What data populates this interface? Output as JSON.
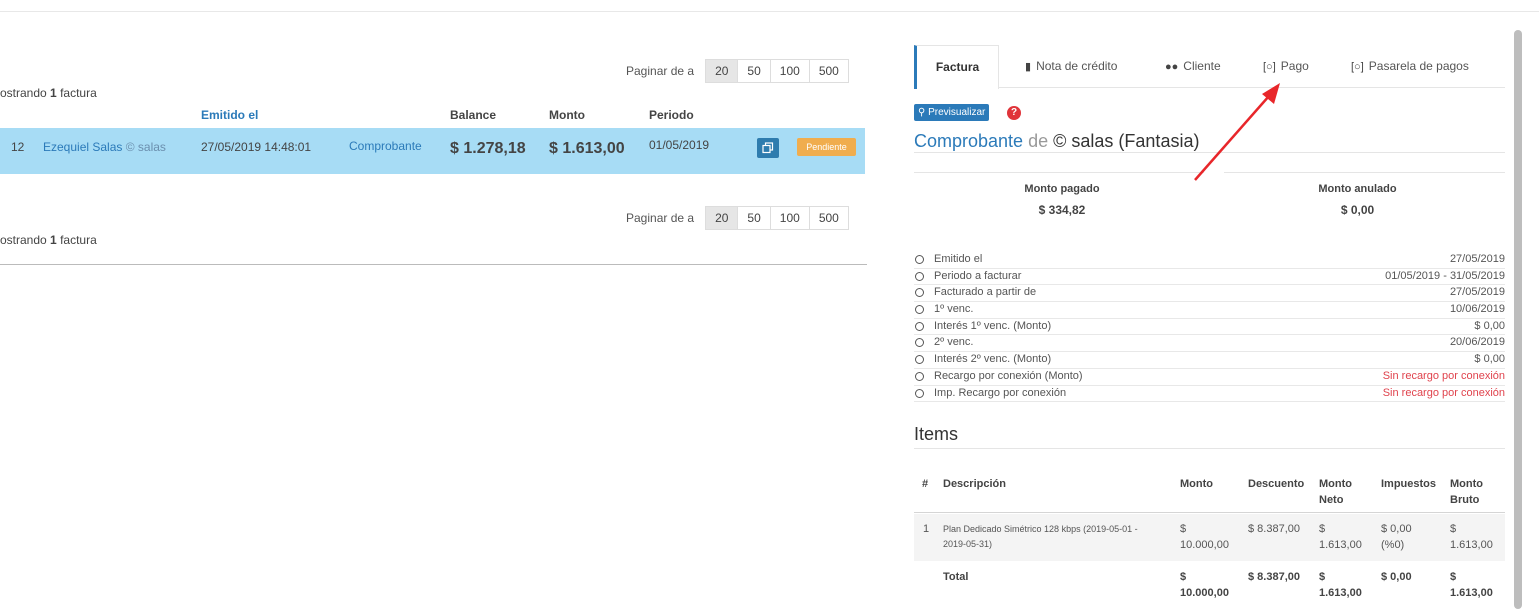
{
  "pager_top": {
    "label": "Paginar de a",
    "options": [
      "20",
      "50",
      "100",
      "500"
    ],
    "active": "20"
  },
  "pager_bottom": {
    "label": "Paginar de a",
    "options": [
      "20",
      "50",
      "100",
      "500"
    ],
    "active": "20"
  },
  "showing_top": {
    "prefix": "ostrando",
    "count": "1",
    "suffix": "factura"
  },
  "showing_bottom": {
    "prefix": "ostrando",
    "count": "1",
    "suffix": "factura"
  },
  "table": {
    "headers": {
      "emitted": "Emitido el",
      "balance": "Balance",
      "amount": "Monto",
      "period": "Periodo"
    },
    "row": {
      "id": "12",
      "client": "Ezequiel Salas",
      "client_tag": "© salas",
      "emitted": "27/05/2019 14:48:01",
      "type": "Comprobante",
      "balance": "$ 1.278,18",
      "amount": "$ 1.613,00",
      "period": "01/05/2019",
      "status": "Pendiente"
    }
  },
  "tabs": [
    {
      "label": "Factura",
      "icon": ""
    },
    {
      "label": "Nota de crédito",
      "icon": "book-icon"
    },
    {
      "label": "Cliente",
      "icon": "users-icon"
    },
    {
      "label": "Pago",
      "icon": "money-icon"
    },
    {
      "label": "Pasarela de pagos",
      "icon": "money-icon"
    }
  ],
  "detail": {
    "preview_label": "Previsualizar",
    "title": {
      "doc": "Comprobante",
      "de": "de",
      "name": "© salas (Fantasia)"
    },
    "paid_label": "Monto pagado",
    "paid_value": "$ 334,82",
    "void_label": "Monto anulado",
    "void_value": "$ 0,00",
    "fields": [
      {
        "k": "Emitido el",
        "v": "27/05/2019"
      },
      {
        "k": "Periodo a facturar",
        "v": "01/05/2019 - 31/05/2019"
      },
      {
        "k": "Facturado a partir de",
        "v": "27/05/2019"
      },
      {
        "k": "1º venc.",
        "v": "10/06/2019"
      },
      {
        "k": "Interés 1º venc. (Monto)",
        "v": "$ 0,00"
      },
      {
        "k": "2º venc.",
        "v": "20/06/2019"
      },
      {
        "k": "Interés 2º venc. (Monto)",
        "v": "$ 0,00"
      },
      {
        "k": "Recargo por conexión (Monto)",
        "v": "Sin recargo por conexión"
      },
      {
        "k": "Imp. Recargo por conexión",
        "v": "Sin recargo por conexión"
      }
    ]
  },
  "items": {
    "title": "Items",
    "headers": {
      "num": "#",
      "desc": "Descripción",
      "amount": "Monto",
      "discount": "Descuento",
      "net_1": "Monto",
      "net_2": "Neto",
      "taxes": "Impuestos",
      "gross_1": "Monto",
      "gross_2": "Bruto"
    },
    "row": {
      "num": "1",
      "desc_1": "Plan Dedicado Simétrico 128 kbps (2019-05-01 -",
      "desc_2": "2019-05-31)",
      "amount_1": "$",
      "amount_2": "10.000,00",
      "discount": "$ 8.387,00",
      "net_1": "$",
      "net_2": "1.613,00",
      "tax_1": "$ 0,00",
      "tax_2": "(%0)",
      "gross_1": "$",
      "gross_2": "1.613,00"
    },
    "total": {
      "label": "Total",
      "amount_1": "$",
      "amount_2": "10.000,00",
      "discount": "$ 8.387,00",
      "net_1": "$",
      "net_2": "1.613,00",
      "tax": "$ 0,00",
      "gross_1": "$",
      "gross_2": "1.613,00"
    }
  },
  "colors": {
    "accent": "#2b7ab9",
    "row_highlight": "#a7dcf5",
    "pending": "#f0ad4e",
    "danger": "#e0434d",
    "annotation_arrow": "#e8262a"
  }
}
